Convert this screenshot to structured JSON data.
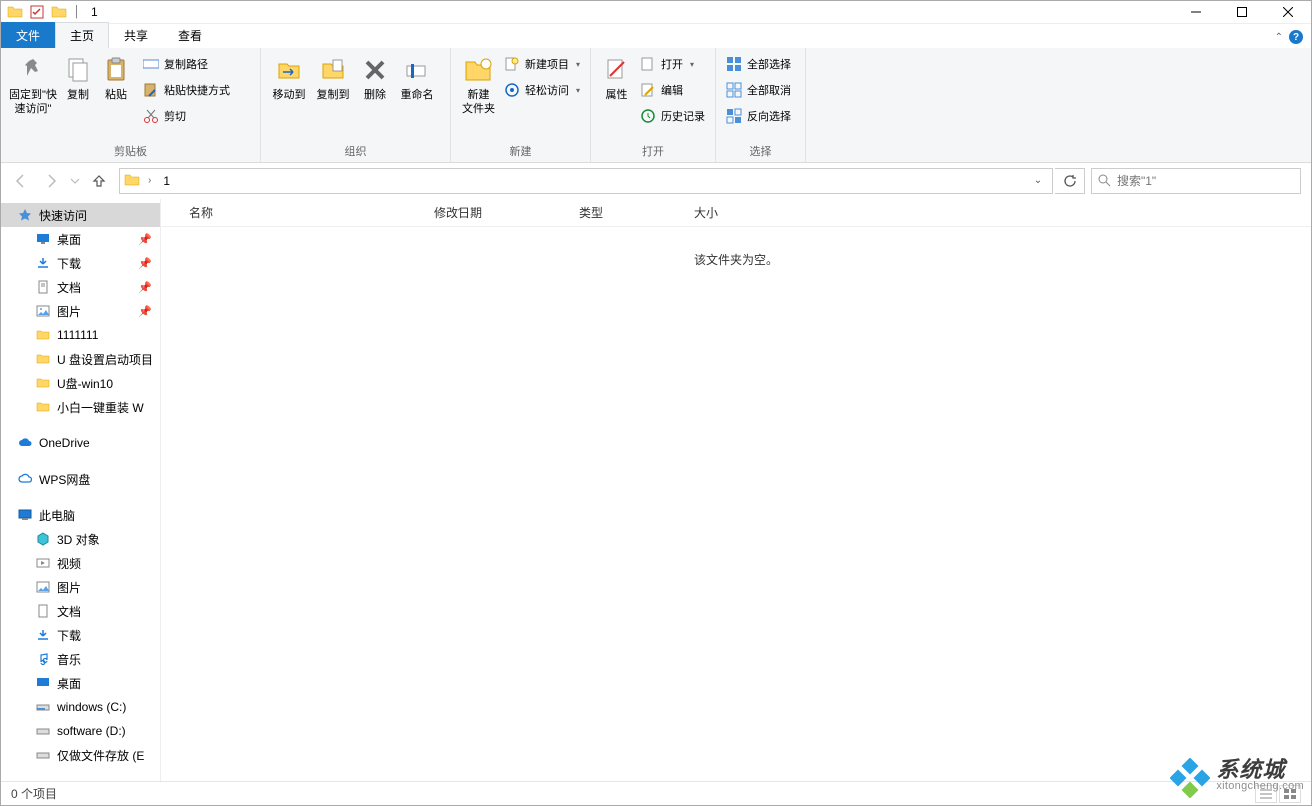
{
  "title": "1",
  "tabs": {
    "file": "文件",
    "home": "主页",
    "share": "共享",
    "view": "查看"
  },
  "ribbon": {
    "clipboard": {
      "pin": "固定到\"快\n速访问\"",
      "copy": "复制",
      "paste": "粘贴",
      "copy_path": "复制路径",
      "paste_shortcut": "粘贴快捷方式",
      "cut": "剪切",
      "label": "剪贴板"
    },
    "organize": {
      "move_to": "移动到",
      "copy_to": "复制到",
      "delete": "删除",
      "rename": "重命名",
      "label": "组织"
    },
    "new": {
      "new_folder": "新建\n文件夹",
      "new_item": "新建项目",
      "easy_access": "轻松访问",
      "label": "新建"
    },
    "open": {
      "properties": "属性",
      "open": "打开",
      "edit": "编辑",
      "history": "历史记录",
      "label": "打开"
    },
    "select": {
      "select_all": "全部选择",
      "select_none": "全部取消",
      "invert": "反向选择",
      "label": "选择"
    }
  },
  "nav": {
    "path": "1",
    "search_placeholder": "搜索\"1\""
  },
  "sidebar": {
    "quick_access": "快速访问",
    "desktop": "桌面",
    "downloads": "下载",
    "documents": "文档",
    "pictures": "图片",
    "f1": "1111111",
    "f2": "U 盘设置启动项目",
    "f3": "U盘-win10",
    "f4": "小白一键重装 W",
    "onedrive": "OneDrive",
    "wps": "WPS网盘",
    "this_pc": "此电脑",
    "objects3d": "3D 对象",
    "videos": "视频",
    "pictures2": "图片",
    "documents2": "文档",
    "downloads2": "下载",
    "music": "音乐",
    "desktop2": "桌面",
    "drive_c": "windows (C:)",
    "drive_d": "software (D:)",
    "drive_e": "仅做文件存放 (E"
  },
  "columns": {
    "name": "名称",
    "date": "修改日期",
    "type": "类型",
    "size": "大小"
  },
  "content": {
    "empty": "该文件夹为空。"
  },
  "status": {
    "items": "0 个项目"
  },
  "watermark": {
    "cn": "系统城",
    "url": "xitongcheng.com"
  }
}
